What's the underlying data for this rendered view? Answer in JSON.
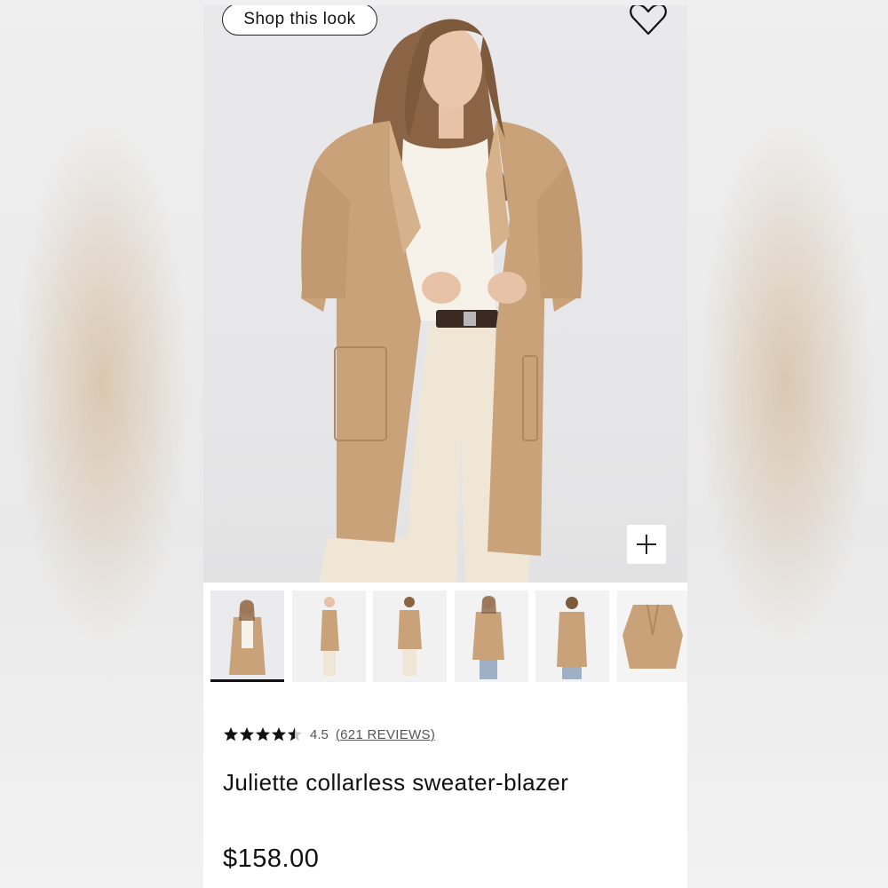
{
  "product": {
    "shop_look_label": "Shop this look",
    "rating_value": "4.5",
    "rating_stars": 4.5,
    "reviews_label": "(621 REVIEWS)",
    "title": "Juliette collarless sweater-blazer",
    "price": "$158.00"
  },
  "gallery": {
    "active_index": 0,
    "thumbnails": [
      {
        "name": "front-view"
      },
      {
        "name": "side-view"
      },
      {
        "name": "side-back-view"
      },
      {
        "name": "styled-view"
      },
      {
        "name": "back-view"
      },
      {
        "name": "flat-lay-view"
      }
    ]
  },
  "colors": {
    "camel": "#c9a27a",
    "text": "#111111",
    "muted": "#555555"
  },
  "icons": {
    "favorite": "heart-icon",
    "zoom": "plus-icon",
    "star": "star-icon"
  }
}
